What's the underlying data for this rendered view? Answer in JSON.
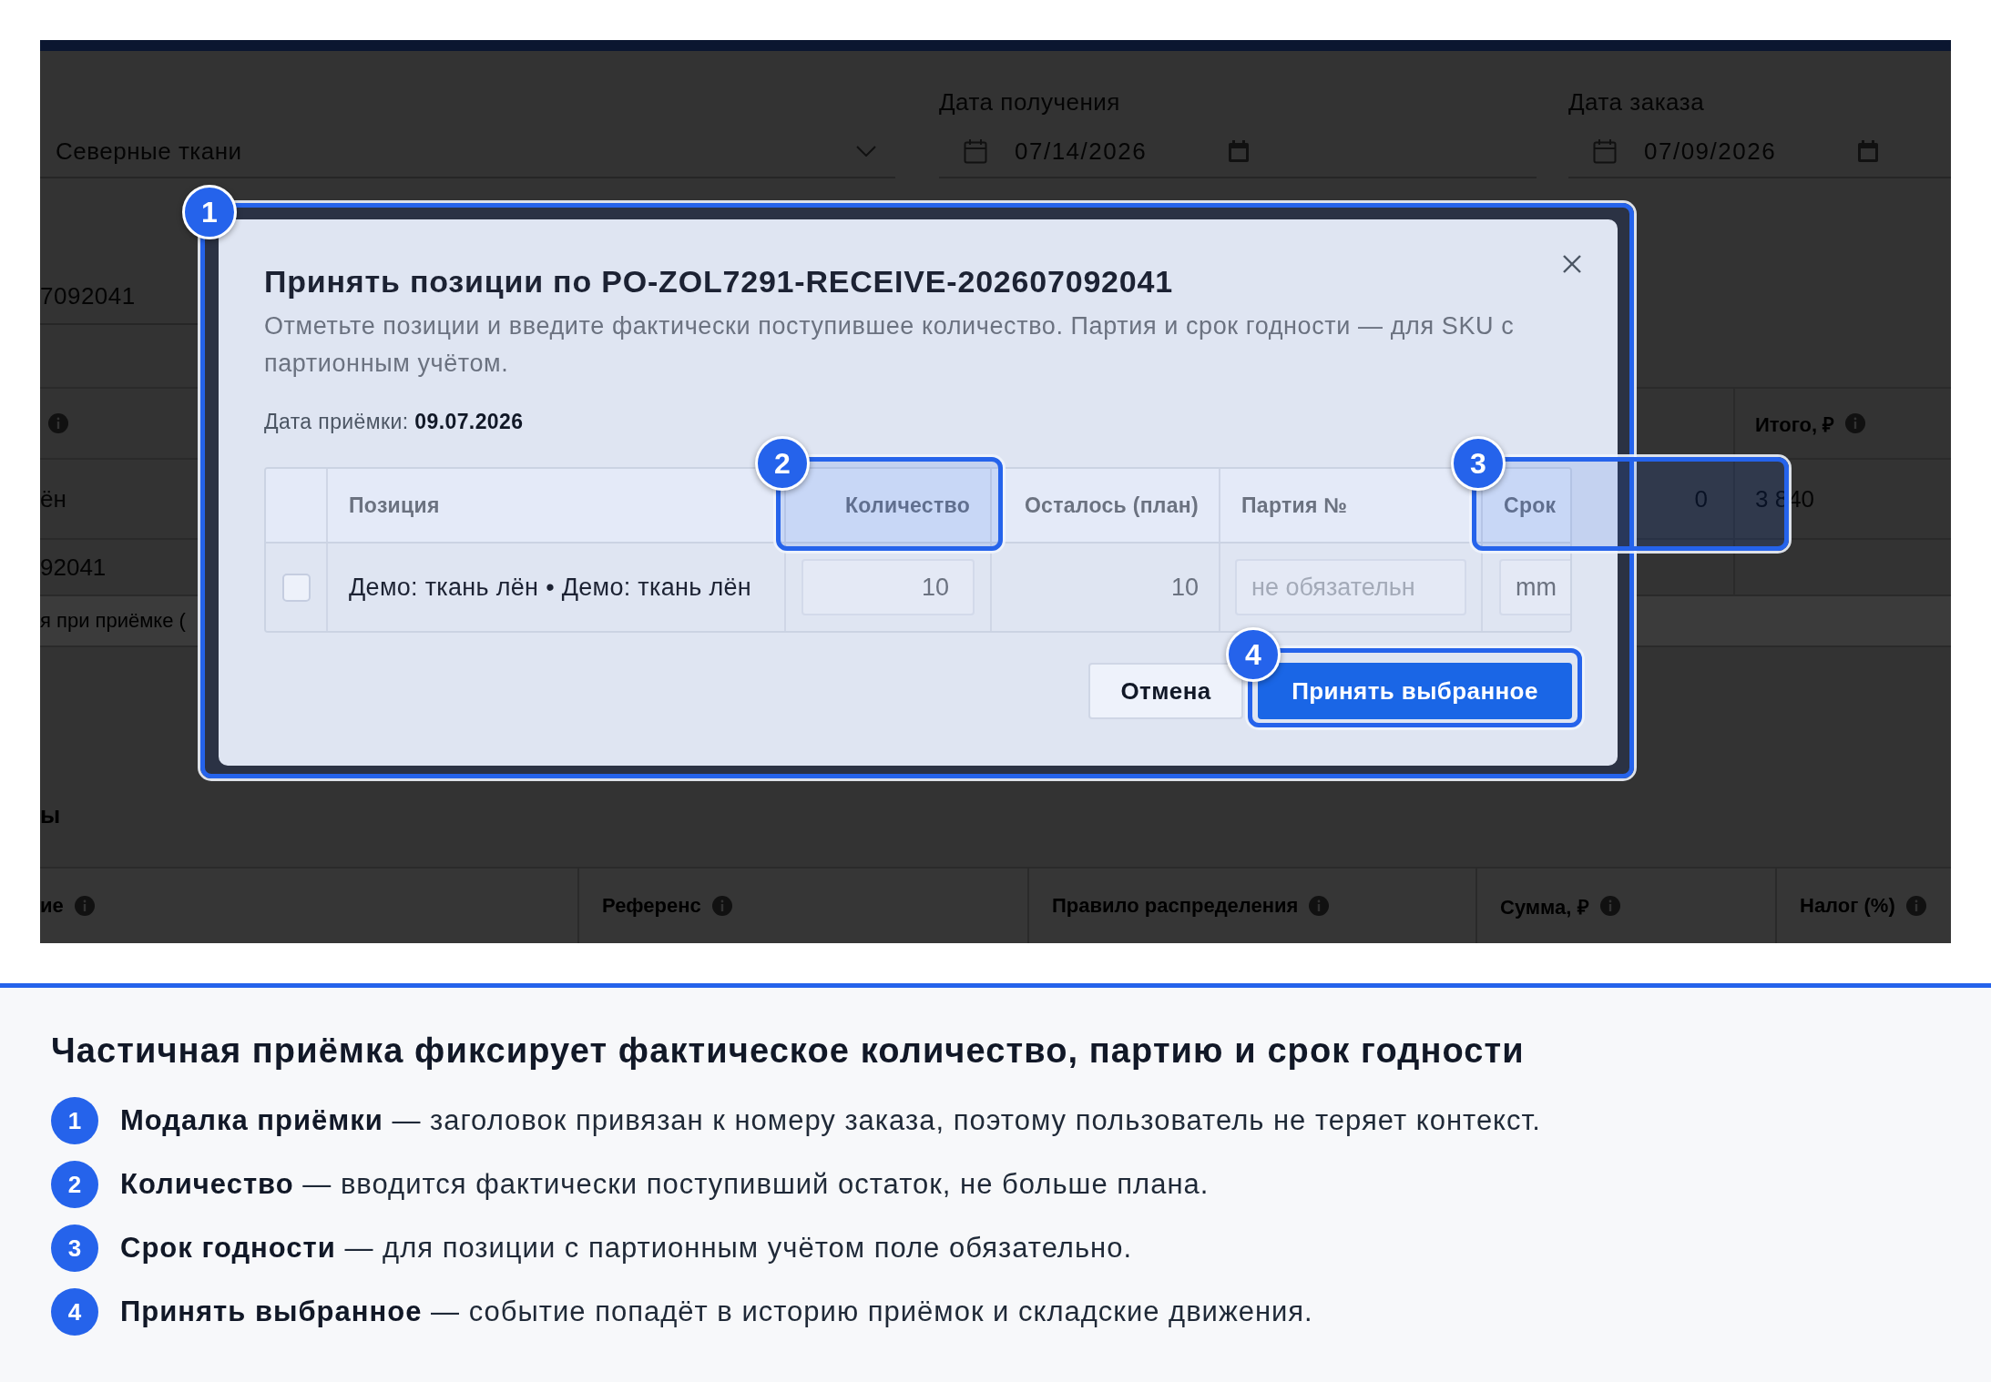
{
  "app_background": {
    "supplier_field": {
      "value": "Северные ткани"
    },
    "date_fields": [
      {
        "label": "Дата получения",
        "value": "07/14/2026"
      },
      {
        "label": "Дата заказа",
        "value": "07/09/2026"
      }
    ],
    "reference_field": {
      "value": "7092041"
    },
    "lines_table": {
      "total_heading": "Итого, ₽",
      "rows": [
        {
          "item": "ён",
          "column_2": "0",
          "total": "3 840"
        },
        {
          "item": "92041"
        }
      ],
      "hint": "я при приёмке ("
    },
    "costs_section": {
      "title": "ы",
      "columns": [
        "ие",
        "Референс",
        "Правило распределения",
        "Сумма, ₽",
        "Налог (%)"
      ]
    }
  },
  "modal": {
    "title": "Принять позиции по PO-ZOL7291-RECEIVE-202607092041",
    "description": "Отметьте позиции и введите фактически поступившее количество. Партия и срок годности — для SKU с партионным учётом.",
    "receipt_date": "Дата приёмки: **09.07.2026**",
    "columns": [
      "Позиция",
      "Количество",
      "Осталось (план)",
      "Партия №",
      "Срок"
    ],
    "rows": [
      {
        "checked": false,
        "item": "Демо: ткань лён • Демо: ткань лён",
        "quantity": "10",
        "remaining": "10",
        "batch_placeholder": "не обязательн",
        "expiry_placeholder": "mm"
      }
    ],
    "buttons": [
      {
        "label": "Отмена",
        "kind": "secondary"
      },
      {
        "label": "Принять выбранное",
        "kind": "primary"
      }
    ]
  },
  "callouts": [
    {
      "number": "1"
    },
    {
      "number": "2"
    },
    {
      "number": "3"
    },
    {
      "number": "4"
    }
  ],
  "caption": {
    "title": "Частичная приёмка фиксирует фактическое количество, партию и срок годности",
    "items": [
      {
        "number": "1",
        "text": "**Модалка приёмки** — заголовок привязан к номеру заказа, поэтому пользователь не теряет контекст."
      },
      {
        "number": "2",
        "text": "**Количество** — вводится фактически поступивший остаток, не больше плана."
      },
      {
        "number": "3",
        "text": "**Срок годности** — для позиции с партионным учётом поле обязательно."
      },
      {
        "number": "4",
        "text": "**Принять выбранное** — событие попадёт в историю приёмок и складские движения."
      }
    ]
  }
}
